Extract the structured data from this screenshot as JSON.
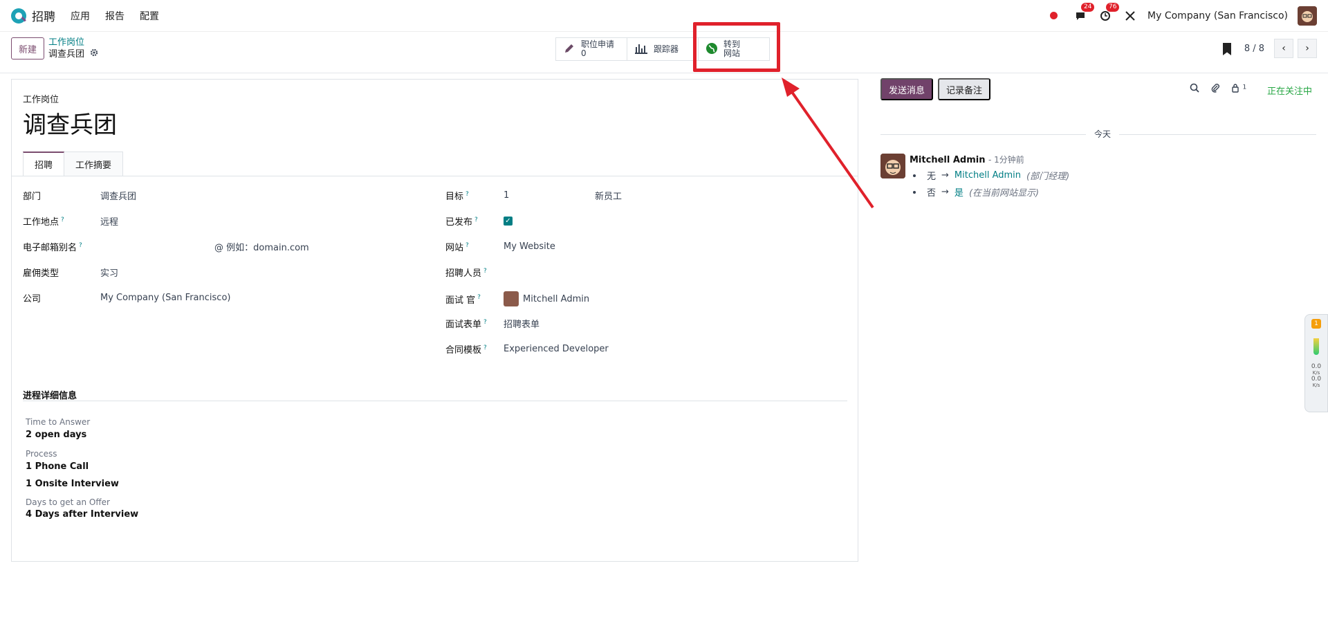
{
  "navbar": {
    "app_name": "招聘",
    "menu": [
      "应用",
      "报告",
      "配置"
    ],
    "messages_count": "24",
    "activities_count": "76",
    "company": "My Company (San Francisco)"
  },
  "control_panel": {
    "new_label": "新建",
    "breadcrumb_parent": "工作岗位",
    "breadcrumb_current": "调查兵团",
    "stat_applications_label": "职位申请",
    "stat_applications_value": "0",
    "stat_tracker_label": "跟踪器",
    "stat_website_line1": "转到",
    "stat_website_line2": "网站",
    "pager_value": "8 / 8"
  },
  "form": {
    "job_label": "工作岗位",
    "job_title": "调查兵团",
    "tabs": [
      "招聘",
      "工作摘要"
    ],
    "left_fields": [
      {
        "label": "部门",
        "value": "调查兵团"
      },
      {
        "label": "工作地点",
        "value": "远程"
      },
      {
        "label": "电子邮箱别名",
        "value": "@ 例如：domain.com"
      },
      {
        "label": "雇佣类型",
        "value": "实习"
      },
      {
        "label": "公司",
        "value": "My Company (San Francisco)"
      }
    ],
    "right_fields": [
      {
        "label": "目标",
        "value": "1",
        "extra": "新员工"
      },
      {
        "label": "已发布",
        "value": "✓"
      },
      {
        "label": "网站",
        "value": "My Website"
      },
      {
        "label": "招聘人员",
        "value": ""
      },
      {
        "label": "面试 官",
        "value": "Mitchell Admin"
      },
      {
        "label": "面试表单",
        "value": "招聘表单"
      },
      {
        "label": "合同模板",
        "value": "Experienced Developer"
      }
    ],
    "process_section": {
      "title": "进程详细信息",
      "time_to_answer_label": "Time to Answer",
      "time_to_answer_value": "2 open days",
      "process_label": "Process",
      "process_step1": "1 Phone Call",
      "process_step2": "1 Onsite Interview",
      "offer_label": "Days to get an Offer",
      "offer_value": "4 Days after Interview"
    }
  },
  "chatter": {
    "send_label": "发送消息",
    "log_label": "记录备注",
    "followers_count": "1",
    "following_label": "正在关注中",
    "date_label": "今天",
    "author": "Mitchell Admin",
    "time": "- 1分钟前",
    "change1_old": "无",
    "change1_new": "Mitchell Admin",
    "change1_note": "(部门经理)",
    "change2_old": "否",
    "change2_new": "是",
    "change2_note": "(在当前网站显示)"
  },
  "side_widget": {
    "badge": "1",
    "up_value": "0.0",
    "up_unit": "K/s",
    "down_value": "0.0",
    "down_unit": "K/s"
  }
}
